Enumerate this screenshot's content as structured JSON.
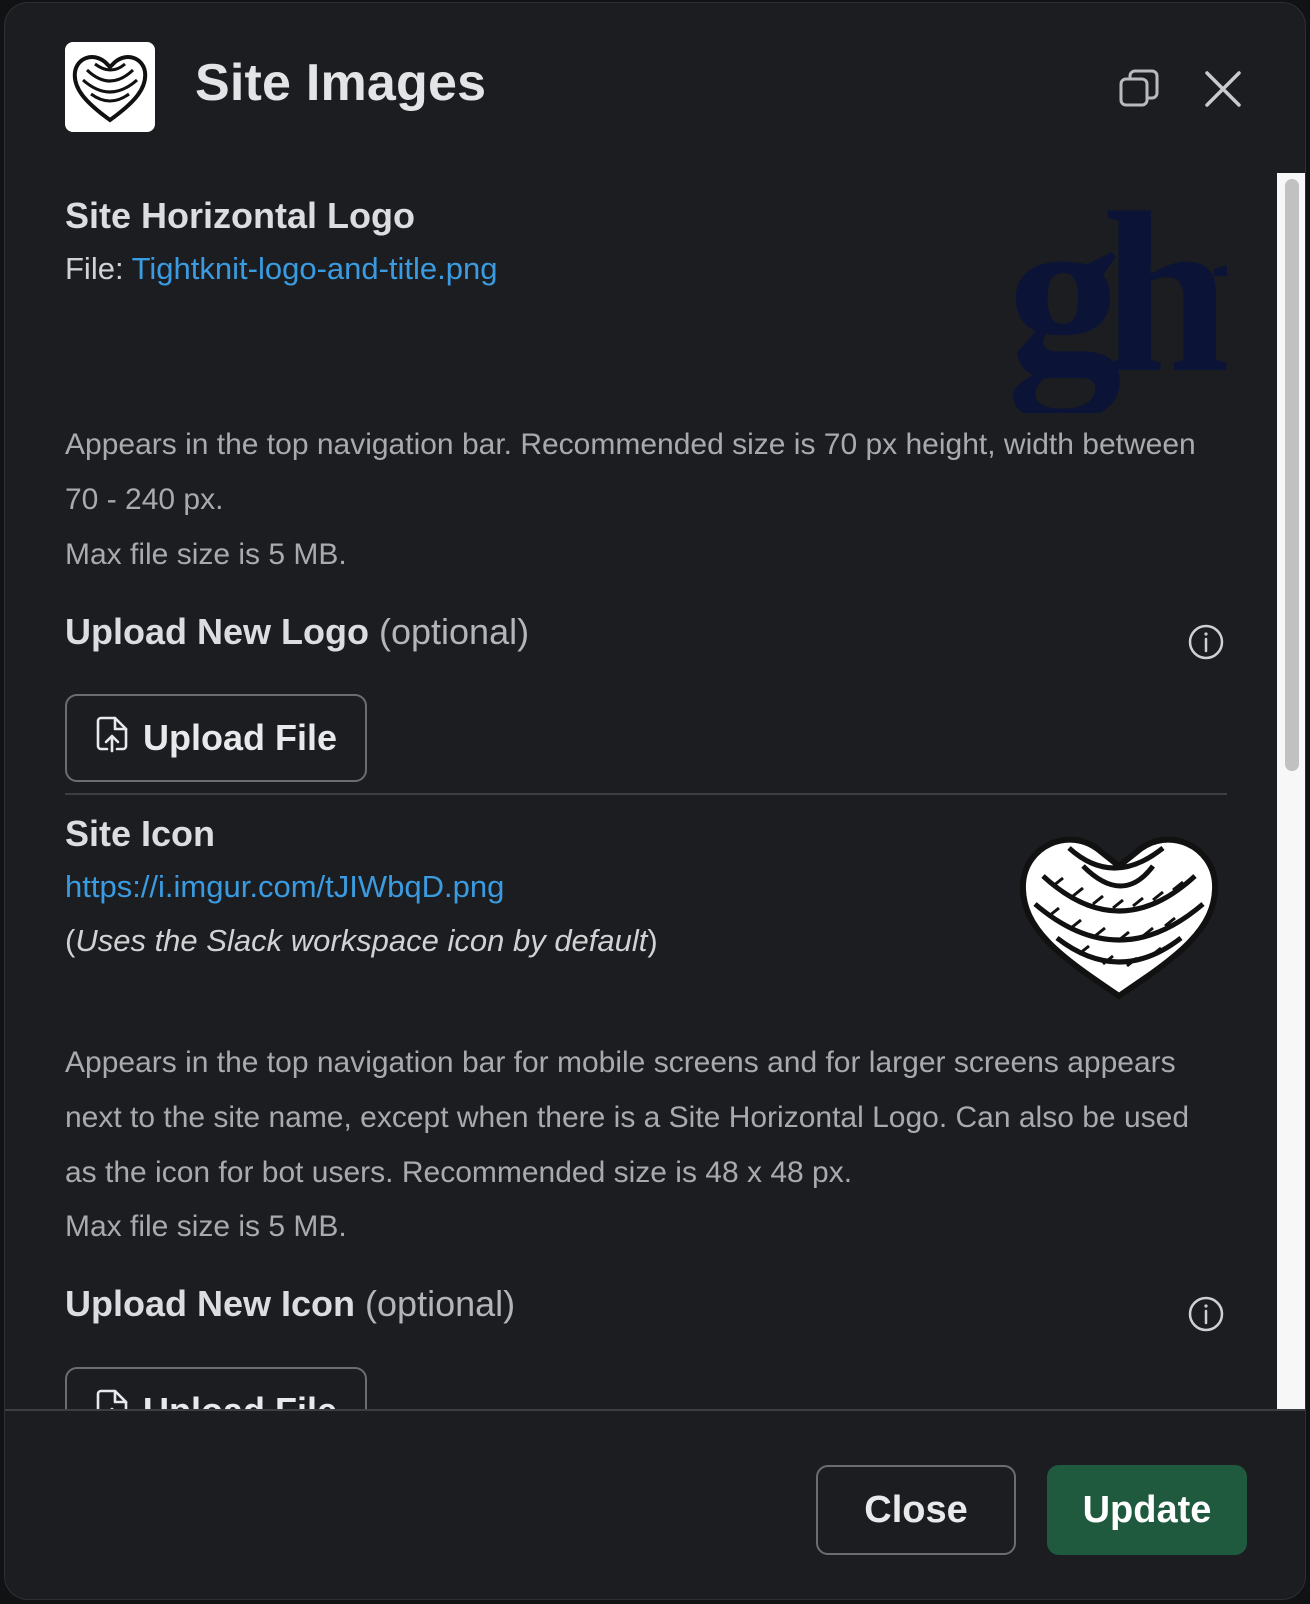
{
  "header": {
    "title": "Site Images",
    "logo_icon": "rope-heart-logo",
    "popout_icon": "popout-icon",
    "close_icon": "close-icon"
  },
  "logo_section": {
    "title": "Site Horizontal Logo",
    "file_prefix": "File: ",
    "file_name": "Tightknit-logo-and-title.png",
    "preview_text": "ght",
    "description_1": "Appears in the top navigation bar. Recommended size is 70 px height, width between 70 - 240 px.",
    "description_2": "Max file size is 5 MB.",
    "upload_label": "Upload New Logo",
    "upload_optional": "(optional)",
    "upload_button": "Upload File"
  },
  "icon_section": {
    "title": "Site Icon",
    "url": "https://i.imgur.com/tJIWbqD.png",
    "default_note_open": "(",
    "default_note": "Uses the Slack workspace icon by default",
    "default_note_close": ")",
    "description_1": "Appears in the top navigation bar for mobile screens and for larger screens appears next to the site name, except when there is a Site Horizontal Logo. Can also be used as the icon for bot users. Recommended size is 48 x 48 px.",
    "description_2": "Max file size is 5 MB.",
    "upload_label": "Upload New Icon",
    "upload_optional": "(optional)",
    "upload_button": "Upload File"
  },
  "footer": {
    "close_label": "Close",
    "update_label": "Update"
  },
  "colors": {
    "background": "#1b1d21",
    "link": "#3a9be0",
    "update_button": "#1f5a3f"
  }
}
